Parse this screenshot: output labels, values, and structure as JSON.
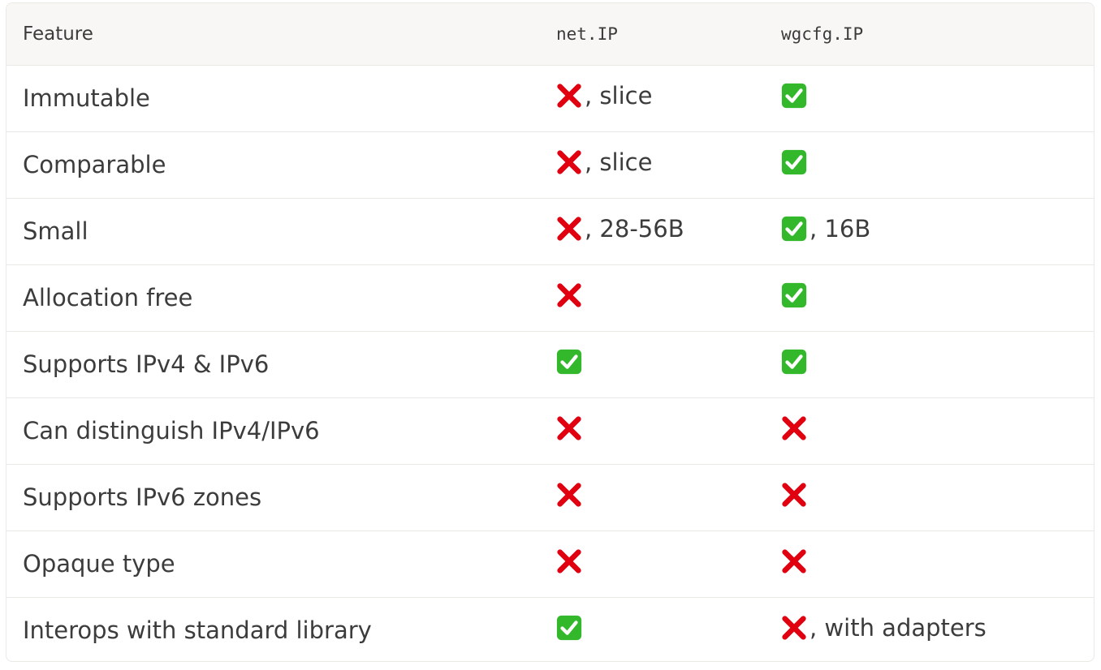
{
  "table": {
    "headers": [
      "Feature",
      "net.IP",
      "wgcfg.IP"
    ],
    "rows": [
      {
        "feature": "Immutable",
        "a": {
          "mark": "cross-mark-icon",
          "note": ", slice"
        },
        "b": {
          "mark": "check-mark-icon",
          "note": ""
        }
      },
      {
        "feature": "Comparable",
        "a": {
          "mark": "cross-mark-icon",
          "note": ", slice"
        },
        "b": {
          "mark": "check-mark-icon",
          "note": ""
        }
      },
      {
        "feature": "Small",
        "a": {
          "mark": "cross-mark-icon",
          "note": ", 28-56B"
        },
        "b": {
          "mark": "check-mark-icon",
          "note": ", 16B"
        }
      },
      {
        "feature": "Allocation free",
        "a": {
          "mark": "cross-mark-icon",
          "note": ""
        },
        "b": {
          "mark": "check-mark-icon",
          "note": ""
        }
      },
      {
        "feature": "Supports IPv4 & IPv6",
        "a": {
          "mark": "check-mark-icon",
          "note": ""
        },
        "b": {
          "mark": "check-mark-icon",
          "note": ""
        }
      },
      {
        "feature": "Can distinguish IPv4/IPv6",
        "a": {
          "mark": "cross-mark-icon",
          "note": ""
        },
        "b": {
          "mark": "cross-mark-icon",
          "note": ""
        }
      },
      {
        "feature": "Supports IPv6 zones",
        "a": {
          "mark": "cross-mark-icon",
          "note": ""
        },
        "b": {
          "mark": "cross-mark-icon",
          "note": ""
        }
      },
      {
        "feature": "Opaque type",
        "a": {
          "mark": "cross-mark-icon",
          "note": ""
        },
        "b": {
          "mark": "cross-mark-icon",
          "note": ""
        }
      },
      {
        "feature": "Interops with standard library",
        "a": {
          "mark": "check-mark-icon",
          "note": ""
        },
        "b": {
          "mark": "cross-mark-icon",
          "note": ", with adapters"
        }
      }
    ]
  },
  "colors": {
    "cross": "#e0000f",
    "check_bg": "#33b82c",
    "check_fg": "#ffffff",
    "header_bg": "#f8f7f5",
    "border": "#ebe9e5",
    "text": "#3c3c3c"
  }
}
